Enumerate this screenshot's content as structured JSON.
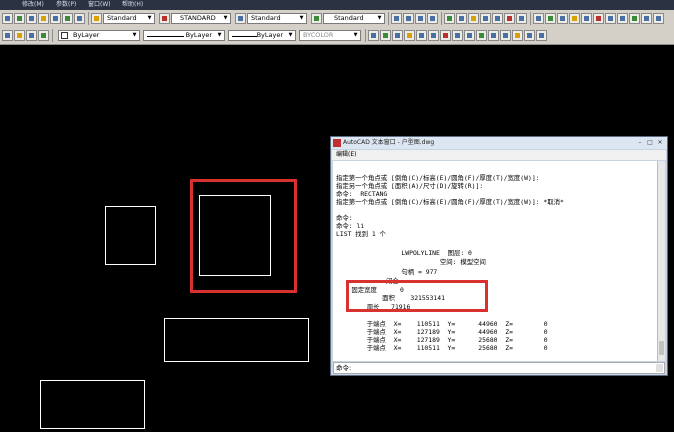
{
  "menubar": {
    "items": [
      "修改(M)",
      "参数(P)",
      "窗口(W)",
      "帮助(H)"
    ]
  },
  "toolbar1": {
    "text_style": "Standard",
    "dim_style": "STANDARD",
    "table_style": "Standard",
    "multileader_style": "Standard"
  },
  "toolbar2": {
    "layer": "ByLayer",
    "linetype": "ByLayer",
    "lineweight": "ByLayer",
    "plotstyle": "BYCOLOR"
  },
  "textwindow": {
    "title": "AutoCAD 文本窗口 - 户型图.dwg",
    "menu": "编辑(E)",
    "lines": [
      "指定第一个角点或 [倒角(C)/标高(E)/圆角(F)/厚度(T)/宽度(W)]:",
      "指定另一个角点或 [面积(A)/尺寸(D)/旋转(R)]:",
      "命令:  RECTANG",
      "指定第一个角点或 [倒角(C)/标高(E)/圆角(F)/厚度(T)/宽度(W)]: *取消*",
      "",
      "命令:",
      "命令: li",
      "LIST 找到 1 个",
      "",
      "                 LWPOLYLINE  图层: 0",
      "                           空间: 模型空间",
      "                 句柄 = 977",
      "             闭合",
      "    固定宽度      0",
      "            面积    321553141",
      "        周长   71916",
      "",
      "        于端点  X=    110511  Y=      44960  Z=        0",
      "        于端点  X=    127189  Y=      44960  Z=        0",
      "        于端点  X=    127189  Y=      25680  Z=        0",
      "        于端点  X=    110511  Y=      25680  Z=        0"
    ],
    "command_prompt": "命令:"
  },
  "colors": {
    "highlight": "#d93030",
    "canvas": "#000000"
  }
}
